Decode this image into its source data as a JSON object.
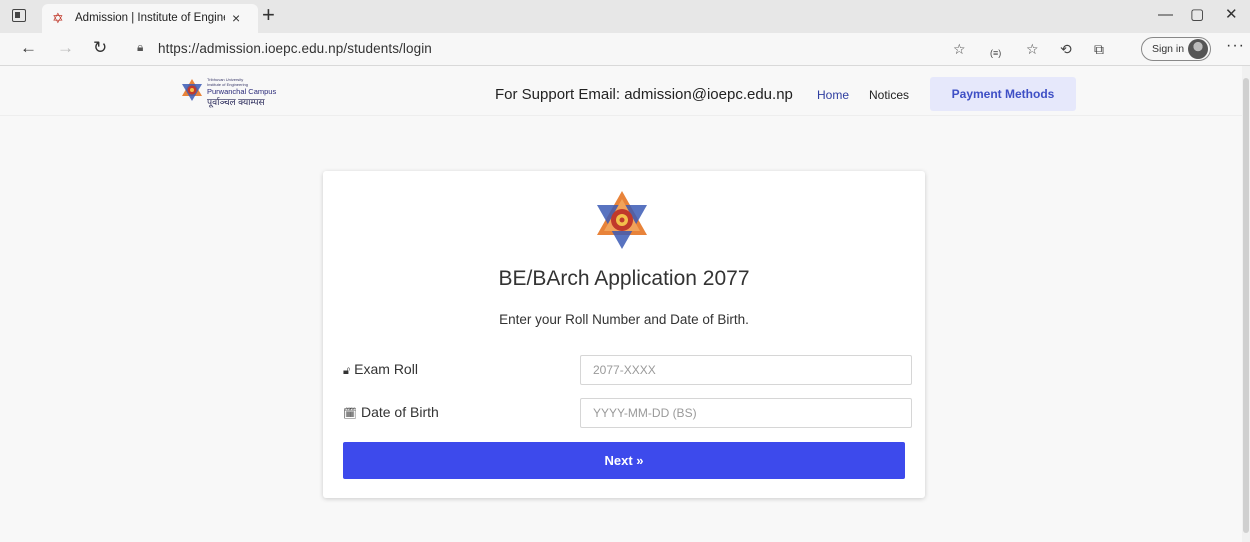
{
  "browser": {
    "tab_title": "Admission | Institute of Engineer",
    "tab_close": "×",
    "new_tab": "+",
    "url": "https://admission.ioepc.edu.np/students/login",
    "sign_in_label": "Sign in",
    "controls": {
      "minimize": "—",
      "maximize": "▢",
      "close": "✕"
    },
    "nav": {
      "back": "←",
      "forward": "→",
      "refresh": "↻"
    }
  },
  "header": {
    "brand": {
      "line1": "Tribhuvan University",
      "line2": "Institute of Engineering",
      "name": "Purwanchal Campus",
      "name_devanagari": "पूर्वाञ्चल क्याम्पस"
    },
    "support_text": "For Support Email: admission@ioepc.edu.np",
    "nav": {
      "home": "Home",
      "notices": "Notices",
      "payment": "Payment Methods"
    }
  },
  "card": {
    "title": "BE/BArch Application 2077",
    "subtitle": "Enter your Roll Number and Date of Birth.",
    "exam_roll": {
      "label": "Exam Roll",
      "icon": "lock-icon",
      "placeholder": "2077-XXXX",
      "value": ""
    },
    "dob": {
      "label": "Date of Birth",
      "icon": "calendar-icon",
      "placeholder": "YYYY-MM-DD (BS)",
      "value": ""
    },
    "next_label": "Next »"
  },
  "colors": {
    "accent": "#3d4aec",
    "payment_bg": "#e6e8fb",
    "payment_text": "#3e4fc5",
    "emblem_red": "#c0392b",
    "emblem_blue": "#3b5bb5"
  }
}
